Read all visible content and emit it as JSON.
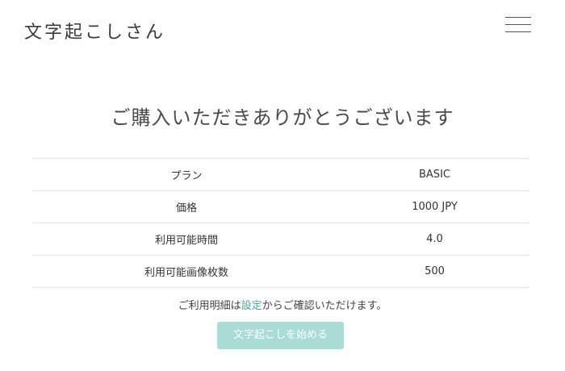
{
  "header": {
    "logo_text": "文字起こしさん",
    "menu_icon": "hamburger-menu-icon"
  },
  "main": {
    "title": "ご購入いただきありがとうございます",
    "rows": [
      {
        "label": "プラン",
        "value": "BASIC"
      },
      {
        "label": "価格",
        "value": "1000 JPY"
      },
      {
        "label": "利用可能時間",
        "value": "4.0"
      },
      {
        "label": "利用可能画像枚数",
        "value": "500"
      }
    ],
    "note": {
      "before": "ご利用明細は",
      "link": "設定",
      "after": "からご確認いただけます。"
    },
    "start_button_label": "文字起こしを始める"
  },
  "colors": {
    "accent": "#a9dcd6",
    "link": "#4aa79e",
    "divider": "#e2e2e2"
  }
}
